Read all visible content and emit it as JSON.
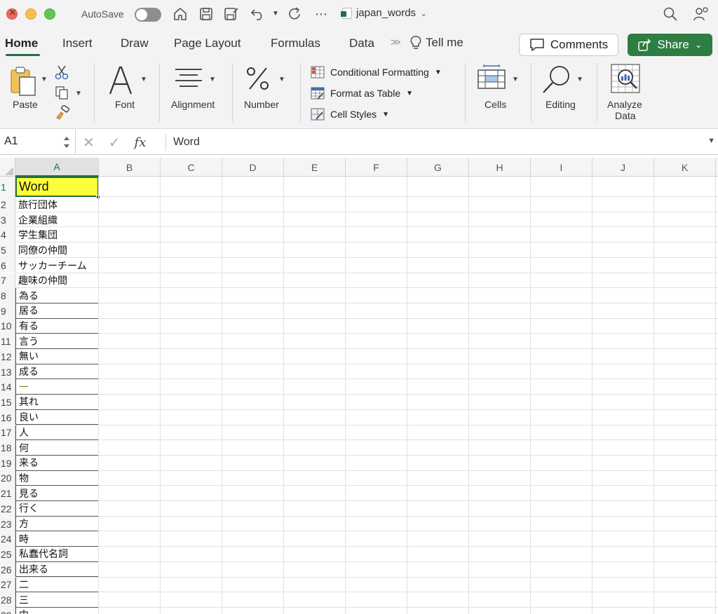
{
  "titlebar": {
    "autosave_label": "AutoSave",
    "document_name": "japan_words"
  },
  "tabs": {
    "items": [
      "Home",
      "Insert",
      "Draw",
      "Page Layout",
      "Formulas",
      "Data"
    ],
    "tell_me": "Tell me",
    "comments_label": "Comments",
    "share_label": "Share",
    "accent_color": "#1e7145",
    "share_color": "#2e7d43"
  },
  "ribbon": {
    "paste_label": "Paste",
    "font_label": "Font",
    "alignment_label": "Alignment",
    "number_label": "Number",
    "conditional_formatting": "Conditional Formatting",
    "format_as_table": "Format as Table",
    "cell_styles": "Cell Styles",
    "cells_label": "Cells",
    "editing_label": "Editing",
    "analyze_line1": "Analyze",
    "analyze_line2": "Data"
  },
  "formula_bar": {
    "name_box": "A1",
    "value": "Word"
  },
  "sheet": {
    "columns": [
      "A",
      "B",
      "C",
      "D",
      "E",
      "F",
      "G",
      "H",
      "I",
      "J",
      "K"
    ],
    "selected_column": "A",
    "selected_cell": "A1",
    "header_fill_color": "#ffff3a",
    "rows": [
      {
        "n": "1",
        "a": "Word"
      },
      {
        "n": "2",
        "a": "旅行団体"
      },
      {
        "n": "3",
        "a": "企業組織"
      },
      {
        "n": "4",
        "a": "学生集団"
      },
      {
        "n": "5",
        "a": "同僚の仲間"
      },
      {
        "n": "6",
        "a": "サッカーチーム"
      },
      {
        "n": "7",
        "a": "趣味の仲間"
      },
      {
        "n": "8",
        "a": "為る"
      },
      {
        "n": "9",
        "a": "居る"
      },
      {
        "n": "10",
        "a": "有る"
      },
      {
        "n": "11",
        "a": "言う"
      },
      {
        "n": "12",
        "a": "無い"
      },
      {
        "n": "13",
        "a": "成る"
      },
      {
        "n": "14",
        "a": "一"
      },
      {
        "n": "15",
        "a": "其れ"
      },
      {
        "n": "16",
        "a": "良い"
      },
      {
        "n": "17",
        "a": "人"
      },
      {
        "n": "18",
        "a": "何"
      },
      {
        "n": "19",
        "a": "来る"
      },
      {
        "n": "20",
        "a": "物"
      },
      {
        "n": "21",
        "a": "見る"
      },
      {
        "n": "22",
        "a": "行く"
      },
      {
        "n": "23",
        "a": "方"
      },
      {
        "n": "24",
        "a": "時"
      },
      {
        "n": "25",
        "a": "私蠢代名詞"
      },
      {
        "n": "26",
        "a": "出来る"
      },
      {
        "n": "27",
        "a": "二"
      },
      {
        "n": "28",
        "a": "三"
      },
      {
        "n": "29",
        "a": "中"
      }
    ]
  }
}
